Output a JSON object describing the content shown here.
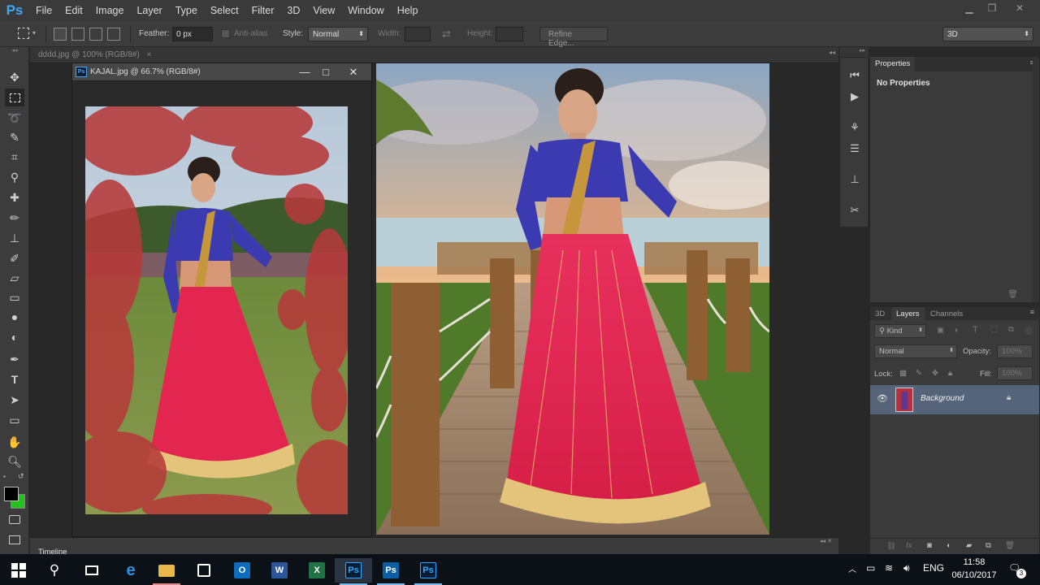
{
  "app": {
    "logo": "Ps",
    "menu": [
      "File",
      "Edit",
      "Image",
      "Layer",
      "Type",
      "Select",
      "Filter",
      "3D",
      "View",
      "Window",
      "Help"
    ],
    "window_controls": [
      "minimize-icon",
      "restore-icon",
      "close-icon"
    ]
  },
  "options_bar": {
    "feather_label": "Feather:",
    "feather_value": "0 px",
    "antialias_label": "Anti-alias",
    "style_label": "Style:",
    "style_value": "Normal",
    "width_label": "Width:",
    "height_label": "Height:",
    "refine_edge": "Refine Edge...",
    "workspace": "3D"
  },
  "tabs": {
    "doc1": "dddd.jpg @ 100% (RGB/8#)",
    "doc1_close": "×"
  },
  "floating_doc": {
    "title": "KAJAL.jpg @ 66.7% (RGB/8#)",
    "icon_text": "Ps",
    "ctrl_min": "—",
    "ctrl_max": "□",
    "ctrl_close": "✕"
  },
  "properties_panel": {
    "tab": "Properties",
    "message": "No Properties"
  },
  "layers_panel": {
    "tabs": [
      "3D",
      "Layers",
      "Channels"
    ],
    "kind": "Kind",
    "blend_mode": "Normal",
    "opacity_label": "Opacity:",
    "opacity_value": "100%",
    "lock_label": "Lock:",
    "fill_label": "Fill:",
    "fill_value": "100%",
    "layer_name": "Background"
  },
  "timeline": {
    "label": "Timeline"
  },
  "taskbar": {
    "apps": [
      {
        "icon": "file-explorer-icon"
      },
      {
        "icon": "edge-icon",
        "text": "e"
      },
      {
        "icon": "folder-icon"
      },
      {
        "icon": "store-icon"
      },
      {
        "icon": "outlook-icon",
        "text": "O"
      },
      {
        "icon": "word-icon",
        "text": "W"
      },
      {
        "icon": "excel-icon",
        "text": "X"
      },
      {
        "icon": "photoshop-icon",
        "text": "Ps"
      },
      {
        "icon": "photoshop-icon",
        "text": "Ps"
      },
      {
        "icon": "photoshop-icon",
        "text": "Ps"
      }
    ],
    "language": "ENG",
    "time": "11:58",
    "date": "06/10/2017",
    "notifications": "3"
  },
  "colors": {
    "accent": "#3fa9f5",
    "fg_color": "#000000",
    "bg_color": "#22c41c",
    "mask_red": "#b63a3a"
  }
}
